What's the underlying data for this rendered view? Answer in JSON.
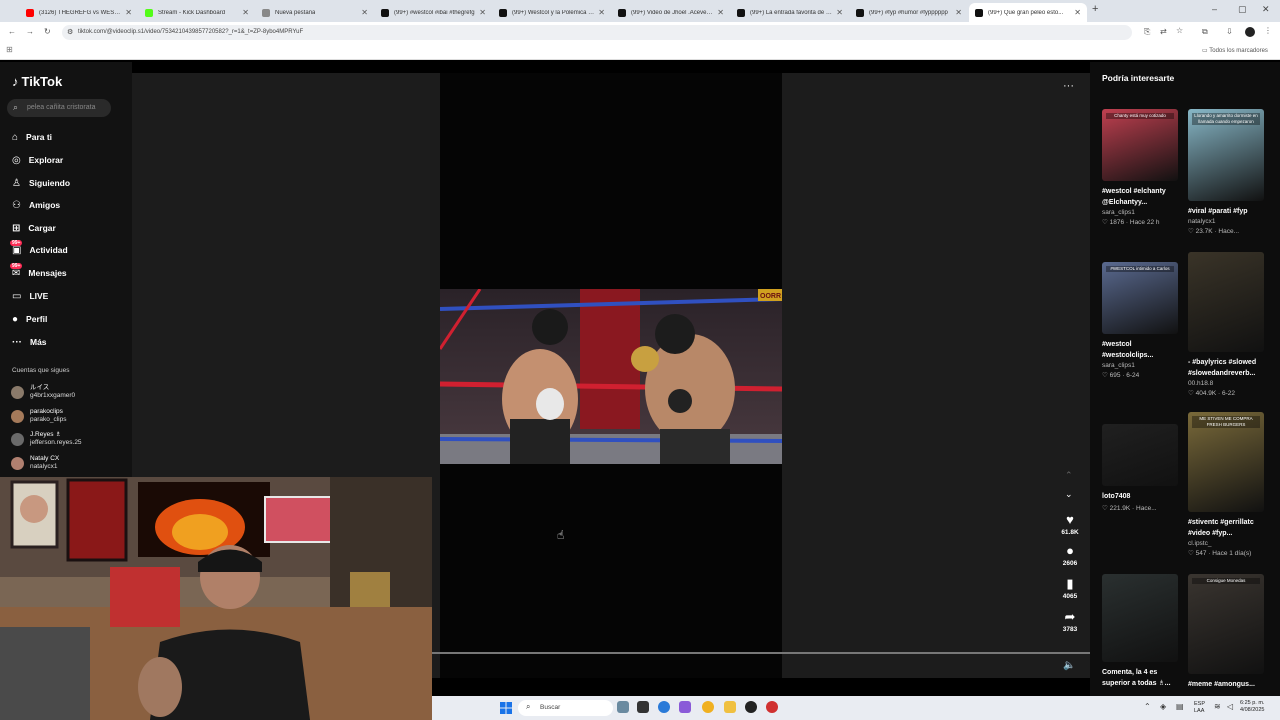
{
  "browser": {
    "tabs": [
      {
        "title": "(3126) THEGREFG vs WESTCOL",
        "color": "#ff0000",
        "active": false
      },
      {
        "title": "Stream - Kick Dashboard",
        "color": "#53fc18",
        "active": false
      },
      {
        "title": "Nueva pestaña",
        "color": "#888888",
        "active": false
      },
      {
        "title": "(99+) #westcol #ibai #thegrefg",
        "color": "#111111",
        "active": false
      },
      {
        "title": "(99+) Westcol y la Polémica en...",
        "color": "#111111",
        "active": false
      },
      {
        "title": "(99+) Video de Jhoel .Acevedo...",
        "color": "#111111",
        "active": false
      },
      {
        "title": "(99+) La entrada favorita de Ibai",
        "color": "#111111",
        "active": false
      },
      {
        "title": "(99+) #fyp #humor #fypppppp",
        "color": "#111111",
        "active": false
      },
      {
        "title": "(99+) Que gran peleo esto...",
        "color": "#111111",
        "active": true
      }
    ],
    "new_tab": "+",
    "url": "tiktok.com/@videoclip.s1/video/7534210439857720582?_r=1&_t=ZP-8ybo4MPRYuF",
    "bookmarks_label": "Todos los marcadores"
  },
  "tiktok": {
    "logo": "TikTok",
    "search_placeholder": "pelea cañita cristorata",
    "nav": [
      {
        "label": "Para ti",
        "icon": "⌂"
      },
      {
        "label": "Explorar",
        "icon": "◎"
      },
      {
        "label": "Siguiendo",
        "icon": "♙"
      },
      {
        "label": "Amigos",
        "icon": "⚇"
      },
      {
        "label": "Cargar",
        "icon": "⊞"
      },
      {
        "label": "Actividad",
        "icon": "▣",
        "badge": "99+"
      },
      {
        "label": "Mensajes",
        "icon": "✉",
        "badge": "99+"
      },
      {
        "label": "LIVE",
        "icon": "▭"
      },
      {
        "label": "Perfil",
        "icon": "●"
      },
      {
        "label": "Más",
        "icon": "···"
      }
    ],
    "following_title": "Cuentas que sigues",
    "following": [
      {
        "name": "ルイス",
        "handle": "g4br1xxgamer0",
        "color": "#8a7a6a"
      },
      {
        "name": "parakoclips",
        "handle": "parako_clips",
        "color": "#a57a5a"
      },
      {
        "name": "J.Reyes ♗",
        "handle": "jefferson.reyes.25",
        "color": "#6a6a6a"
      },
      {
        "name": "Nataly CX",
        "handle": "natalycx1",
        "color": "#b08070"
      }
    ],
    "video": {
      "banner_text": "OORR",
      "actions": {
        "likes": "61.8K",
        "comments": "2606",
        "saves": "4065",
        "shares": "3783"
      }
    },
    "suggestions_title": "Podría interesarte",
    "suggestions": [
      {
        "title": "#westcol #elchanty @Elchantyy...",
        "user": "sara_clips1",
        "meta": "1876 · Hace 22 h",
        "bg": "#c04050",
        "overlay": "Chanty está muy cotizado"
      },
      {
        "title": "#viral #parati #fyp",
        "user": "natalycx1",
        "meta": "23.7K · Hace...",
        "bg": "#88b8c8",
        "overlay": "Llorando y amarrito dormiste en llamada cuando empezaron"
      },
      {
        "title": "#westcol #westcolclips...",
        "user": "sara_clips1",
        "meta": "695 · 6-24",
        "bg": "#5a6a90",
        "overlay": "#WESTCOL intimido a Carlos"
      },
      {
        "title": "- #baylyrics #slowed #slowedandreverb...",
        "user": "00.h18.8",
        "meta": "404.9K · 6-22",
        "bg": "#3a3428",
        "overlay": ""
      },
      {
        "title": "loto7408",
        "user": "",
        "meta": "221.9K · Hace...",
        "bg": "#202020",
        "overlay": ""
      },
      {
        "title": "#stiventc #gerrillatc #video #fyp...",
        "user": "cl.ipstc_",
        "meta": "547 · Hace 1 día(s)",
        "bg": "#7a6a3a",
        "overlay": "ME STIVEN ME COMPRA FRESH BURGERS"
      },
      {
        "title": "Comenta, la 4 es superior a todas ♗...",
        "user": "",
        "meta": "",
        "bg": "#2a3030",
        "overlay": ""
      },
      {
        "title": "#meme #amongus...",
        "user": "",
        "meta": "",
        "bg": "#3a3530",
        "overlay": "Consigue Monedas"
      }
    ]
  },
  "taskbar": {
    "search_label": "Buscar",
    "lang": "ESP",
    "lang2": "LAA",
    "time": "6:25 p. m.",
    "date": "4/08/2025"
  }
}
